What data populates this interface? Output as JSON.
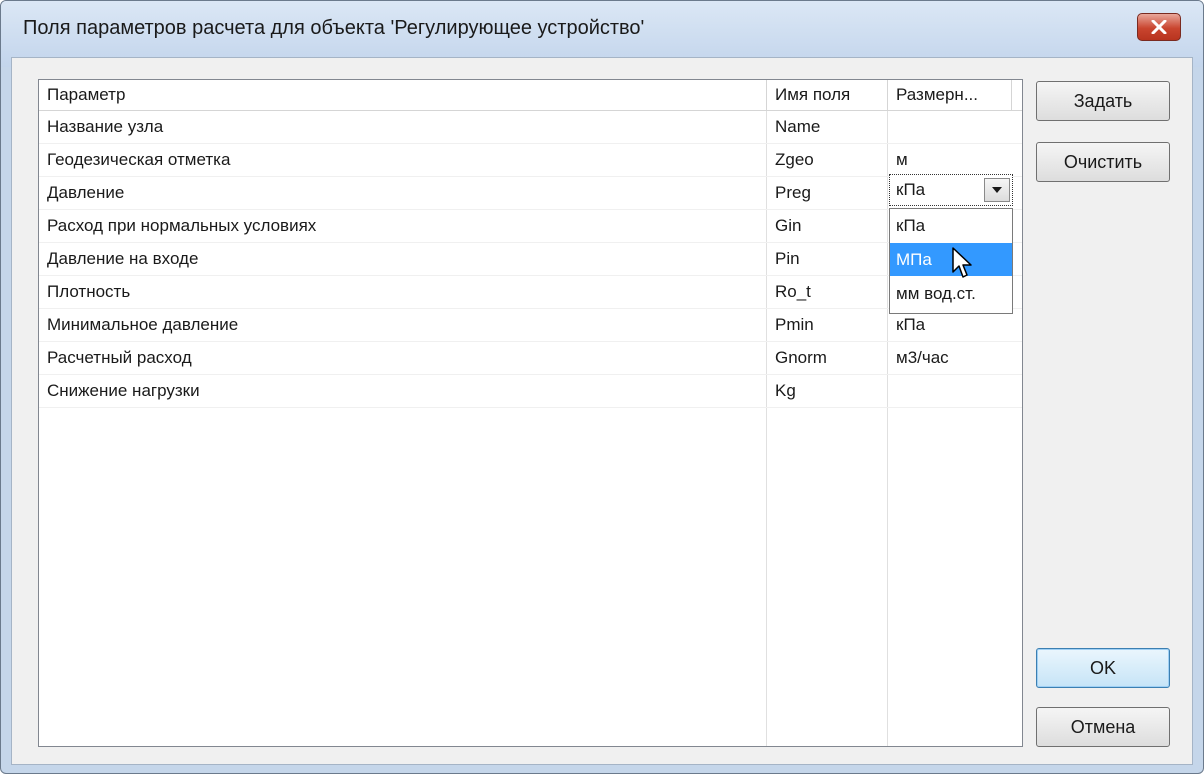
{
  "window": {
    "title": "Поля параметров расчета для объекта 'Регулирующее устройство'"
  },
  "table": {
    "columns": [
      "Параметр",
      "Имя поля",
      "Размерн..."
    ],
    "rows": [
      {
        "param": "Название узла",
        "field": "Name",
        "unit": ""
      },
      {
        "param": "Геодезическая отметка",
        "field": "Zgeo",
        "unit": "м"
      },
      {
        "param": "Давление",
        "field": "Preg",
        "unit": ""
      },
      {
        "param": "Расход при нормальных условиях",
        "field": "Gin",
        "unit": ""
      },
      {
        "param": "Давление на входе",
        "field": "Pin",
        "unit": ""
      },
      {
        "param": "Плотность",
        "field": "Ro_t",
        "unit": ""
      },
      {
        "param": "Минимальное давление",
        "field": "Pmin",
        "unit": "кПа"
      },
      {
        "param": "Расчетный расход",
        "field": "Gnorm",
        "unit": "м3/час"
      },
      {
        "param": "Снижение нагрузки",
        "field": "Kg",
        "unit": ""
      }
    ]
  },
  "unit_combo": {
    "value": "кПа",
    "options": [
      "кПа",
      "МПа",
      "мм вод.ст."
    ],
    "highlighted": "МПа"
  },
  "buttons": {
    "set": "Задать",
    "clear": "Очистить",
    "ok": "OK",
    "cancel": "Отмена"
  },
  "colors": {
    "title_bg": "#c3d5ec",
    "close_button": "#c9452f",
    "highlight": "#3399ff"
  }
}
